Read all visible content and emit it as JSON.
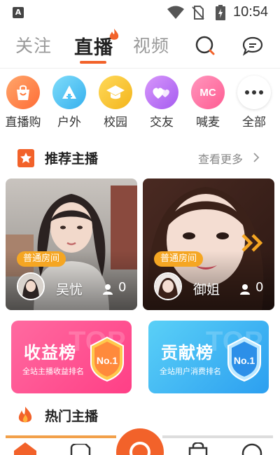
{
  "status_bar": {
    "app_indicator": "A",
    "time": "10:54"
  },
  "nav": {
    "tabs": [
      {
        "label": "关注",
        "active": false
      },
      {
        "label": "直播",
        "active": true
      },
      {
        "label": "视频",
        "active": false
      }
    ],
    "accent_color": "#f2622a"
  },
  "categories": [
    {
      "label": "直播购",
      "icon": "shopping-bag-icon",
      "color": "#ff8a4c"
    },
    {
      "label": "户外",
      "icon": "tent-icon",
      "color": "#4fc3f7"
    },
    {
      "label": "校园",
      "icon": "graduation-cap-icon",
      "color": "#f7c934"
    },
    {
      "label": "交友",
      "icon": "hearts-icon",
      "color": "#c27ef5"
    },
    {
      "label": "喊麦",
      "icon": "mc-icon",
      "color": "#ff7aa8",
      "text": "MC"
    },
    {
      "label": "全部",
      "icon": "more-dots-icon",
      "color": "#ffffff"
    }
  ],
  "recommended": {
    "title": "推荐主播",
    "more_label": "查看更多",
    "cards": [
      {
        "room_type": "普通房间",
        "name": "吴忧",
        "viewers": "0"
      },
      {
        "room_type": "普通房间",
        "name": "御姐",
        "viewers": "0"
      }
    ]
  },
  "rankings": [
    {
      "title": "收益榜",
      "subtitle": "全站主播收益排名",
      "medal": "No.1",
      "watermark": "TOP"
    },
    {
      "title": "贡献榜",
      "subtitle": "全站用户消费排名",
      "medal": "No.1",
      "watermark": "TOP"
    }
  ],
  "hot": {
    "title": "热门主播"
  }
}
